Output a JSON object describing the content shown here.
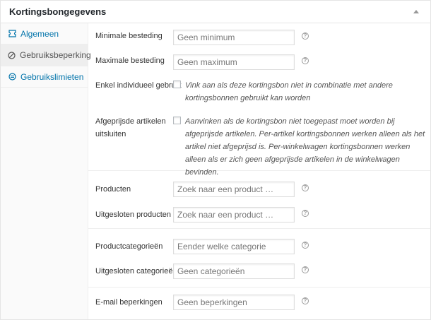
{
  "header": {
    "title": "Kortingsbongegevens"
  },
  "tabs": [
    {
      "label": "Algemeen",
      "icon": "ticket-icon"
    },
    {
      "label": "Gebruiksbeperking",
      "icon": "ban-icon"
    },
    {
      "label": "Gebruikslimieten",
      "icon": "limit-icon"
    }
  ],
  "fields": {
    "min_spend": {
      "label": "Minimale besteding",
      "placeholder": "Geen minimum"
    },
    "max_spend": {
      "label": "Maximale besteding",
      "placeholder": "Geen maximum"
    },
    "individual_use": {
      "label": "Enkel individueel gebruik",
      "description": "Vink aan als deze kortingsbon niet in combinatie met andere kortingsbonnen gebruikt kan worden"
    },
    "exclude_sale": {
      "label": "Afgeprijsde artikelen uitsluiten",
      "description": "Aanvinken als de kortingsbon niet toegepast moet worden bij afgeprijsde artikelen. Per-artikel kortingsbonnen werken alleen als het artikel niet afgeprijsd is. Per-winkelwagen kortingsbonnen werken alleen als er zich geen afgeprijsde artikelen in de winkelwagen bevinden."
    },
    "products": {
      "label": "Producten",
      "placeholder": "Zoek naar een product …"
    },
    "exclude_products": {
      "label": "Uitgesloten producten",
      "placeholder": "Zoek naar een product …"
    },
    "categories": {
      "label": "Productcategorieën",
      "placeholder": "Eender welke categorie"
    },
    "exclude_categories": {
      "label": "Uitgesloten categorieën",
      "placeholder": "Geen categorieën"
    },
    "email": {
      "label": "E-mail beperkingen",
      "placeholder": "Geen beperkingen"
    }
  },
  "help_icon": "?"
}
